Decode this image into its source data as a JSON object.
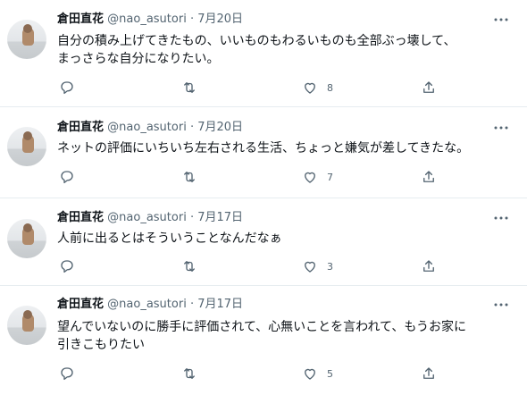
{
  "tweets": [
    {
      "name": "倉田直花",
      "handle": "@nao_asutori",
      "separator": "·",
      "date": "7月20日",
      "text_lines": [
        "自分の積み上げてきたもの、いいものもわるいものも全部ぶっ壊して、",
        "まっさらな自分になりたい。"
      ],
      "like_count": "8"
    },
    {
      "name": "倉田直花",
      "handle": "@nao_asutori",
      "separator": "·",
      "date": "7月20日",
      "text_lines": [
        "ネットの評価にいちいち左右される生活、ちょっと嫌気が差してきたな。"
      ],
      "like_count": "7"
    },
    {
      "name": "倉田直花",
      "handle": "@nao_asutori",
      "separator": "·",
      "date": "7月17日",
      "text_lines": [
        "人前に出るとはそういうことなんだなぁ"
      ],
      "like_count": "3"
    },
    {
      "name": "倉田直花",
      "handle": "@nao_asutori",
      "separator": "·",
      "date": "7月17日",
      "text_lines": [
        "望んでいないのに勝手に評価されて、心無いことを言われて、もうお家に",
        "引きこもりたい"
      ],
      "like_count": "5"
    }
  ],
  "icons": {
    "more": "more-horizontal-icon",
    "reply": "reply-icon",
    "retweet": "retweet-icon",
    "like": "like-icon",
    "share": "share-icon"
  },
  "colors": {
    "name": "#0f1419",
    "secondary": "#536471",
    "divider": "#e6ecf0"
  }
}
